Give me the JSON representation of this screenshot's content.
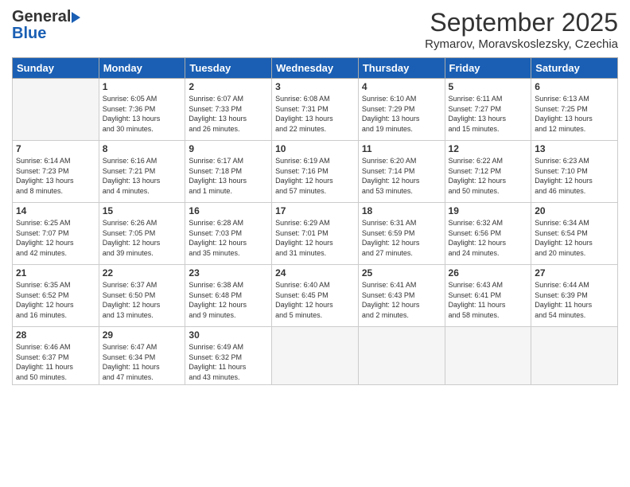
{
  "header": {
    "logo_general": "General",
    "logo_blue": "Blue",
    "month_title": "September 2025",
    "location": "Rymarov, Moravskoslezsky, Czechia"
  },
  "weekdays": [
    "Sunday",
    "Monday",
    "Tuesday",
    "Wednesday",
    "Thursday",
    "Friday",
    "Saturday"
  ],
  "weeks": [
    [
      {
        "day": "",
        "info": ""
      },
      {
        "day": "1",
        "info": "Sunrise: 6:05 AM\nSunset: 7:36 PM\nDaylight: 13 hours\nand 30 minutes."
      },
      {
        "day": "2",
        "info": "Sunrise: 6:07 AM\nSunset: 7:33 PM\nDaylight: 13 hours\nand 26 minutes."
      },
      {
        "day": "3",
        "info": "Sunrise: 6:08 AM\nSunset: 7:31 PM\nDaylight: 13 hours\nand 22 minutes."
      },
      {
        "day": "4",
        "info": "Sunrise: 6:10 AM\nSunset: 7:29 PM\nDaylight: 13 hours\nand 19 minutes."
      },
      {
        "day": "5",
        "info": "Sunrise: 6:11 AM\nSunset: 7:27 PM\nDaylight: 13 hours\nand 15 minutes."
      },
      {
        "day": "6",
        "info": "Sunrise: 6:13 AM\nSunset: 7:25 PM\nDaylight: 13 hours\nand 12 minutes."
      }
    ],
    [
      {
        "day": "7",
        "info": "Sunrise: 6:14 AM\nSunset: 7:23 PM\nDaylight: 13 hours\nand 8 minutes."
      },
      {
        "day": "8",
        "info": "Sunrise: 6:16 AM\nSunset: 7:21 PM\nDaylight: 13 hours\nand 4 minutes."
      },
      {
        "day": "9",
        "info": "Sunrise: 6:17 AM\nSunset: 7:18 PM\nDaylight: 13 hours\nand 1 minute."
      },
      {
        "day": "10",
        "info": "Sunrise: 6:19 AM\nSunset: 7:16 PM\nDaylight: 12 hours\nand 57 minutes."
      },
      {
        "day": "11",
        "info": "Sunrise: 6:20 AM\nSunset: 7:14 PM\nDaylight: 12 hours\nand 53 minutes."
      },
      {
        "day": "12",
        "info": "Sunrise: 6:22 AM\nSunset: 7:12 PM\nDaylight: 12 hours\nand 50 minutes."
      },
      {
        "day": "13",
        "info": "Sunrise: 6:23 AM\nSunset: 7:10 PM\nDaylight: 12 hours\nand 46 minutes."
      }
    ],
    [
      {
        "day": "14",
        "info": "Sunrise: 6:25 AM\nSunset: 7:07 PM\nDaylight: 12 hours\nand 42 minutes."
      },
      {
        "day": "15",
        "info": "Sunrise: 6:26 AM\nSunset: 7:05 PM\nDaylight: 12 hours\nand 39 minutes."
      },
      {
        "day": "16",
        "info": "Sunrise: 6:28 AM\nSunset: 7:03 PM\nDaylight: 12 hours\nand 35 minutes."
      },
      {
        "day": "17",
        "info": "Sunrise: 6:29 AM\nSunset: 7:01 PM\nDaylight: 12 hours\nand 31 minutes."
      },
      {
        "day": "18",
        "info": "Sunrise: 6:31 AM\nSunset: 6:59 PM\nDaylight: 12 hours\nand 27 minutes."
      },
      {
        "day": "19",
        "info": "Sunrise: 6:32 AM\nSunset: 6:56 PM\nDaylight: 12 hours\nand 24 minutes."
      },
      {
        "day": "20",
        "info": "Sunrise: 6:34 AM\nSunset: 6:54 PM\nDaylight: 12 hours\nand 20 minutes."
      }
    ],
    [
      {
        "day": "21",
        "info": "Sunrise: 6:35 AM\nSunset: 6:52 PM\nDaylight: 12 hours\nand 16 minutes."
      },
      {
        "day": "22",
        "info": "Sunrise: 6:37 AM\nSunset: 6:50 PM\nDaylight: 12 hours\nand 13 minutes."
      },
      {
        "day": "23",
        "info": "Sunrise: 6:38 AM\nSunset: 6:48 PM\nDaylight: 12 hours\nand 9 minutes."
      },
      {
        "day": "24",
        "info": "Sunrise: 6:40 AM\nSunset: 6:45 PM\nDaylight: 12 hours\nand 5 minutes."
      },
      {
        "day": "25",
        "info": "Sunrise: 6:41 AM\nSunset: 6:43 PM\nDaylight: 12 hours\nand 2 minutes."
      },
      {
        "day": "26",
        "info": "Sunrise: 6:43 AM\nSunset: 6:41 PM\nDaylight: 11 hours\nand 58 minutes."
      },
      {
        "day": "27",
        "info": "Sunrise: 6:44 AM\nSunset: 6:39 PM\nDaylight: 11 hours\nand 54 minutes."
      }
    ],
    [
      {
        "day": "28",
        "info": "Sunrise: 6:46 AM\nSunset: 6:37 PM\nDaylight: 11 hours\nand 50 minutes."
      },
      {
        "day": "29",
        "info": "Sunrise: 6:47 AM\nSunset: 6:34 PM\nDaylight: 11 hours\nand 47 minutes."
      },
      {
        "day": "30",
        "info": "Sunrise: 6:49 AM\nSunset: 6:32 PM\nDaylight: 11 hours\nand 43 minutes."
      },
      {
        "day": "",
        "info": ""
      },
      {
        "day": "",
        "info": ""
      },
      {
        "day": "",
        "info": ""
      },
      {
        "day": "",
        "info": ""
      }
    ]
  ]
}
